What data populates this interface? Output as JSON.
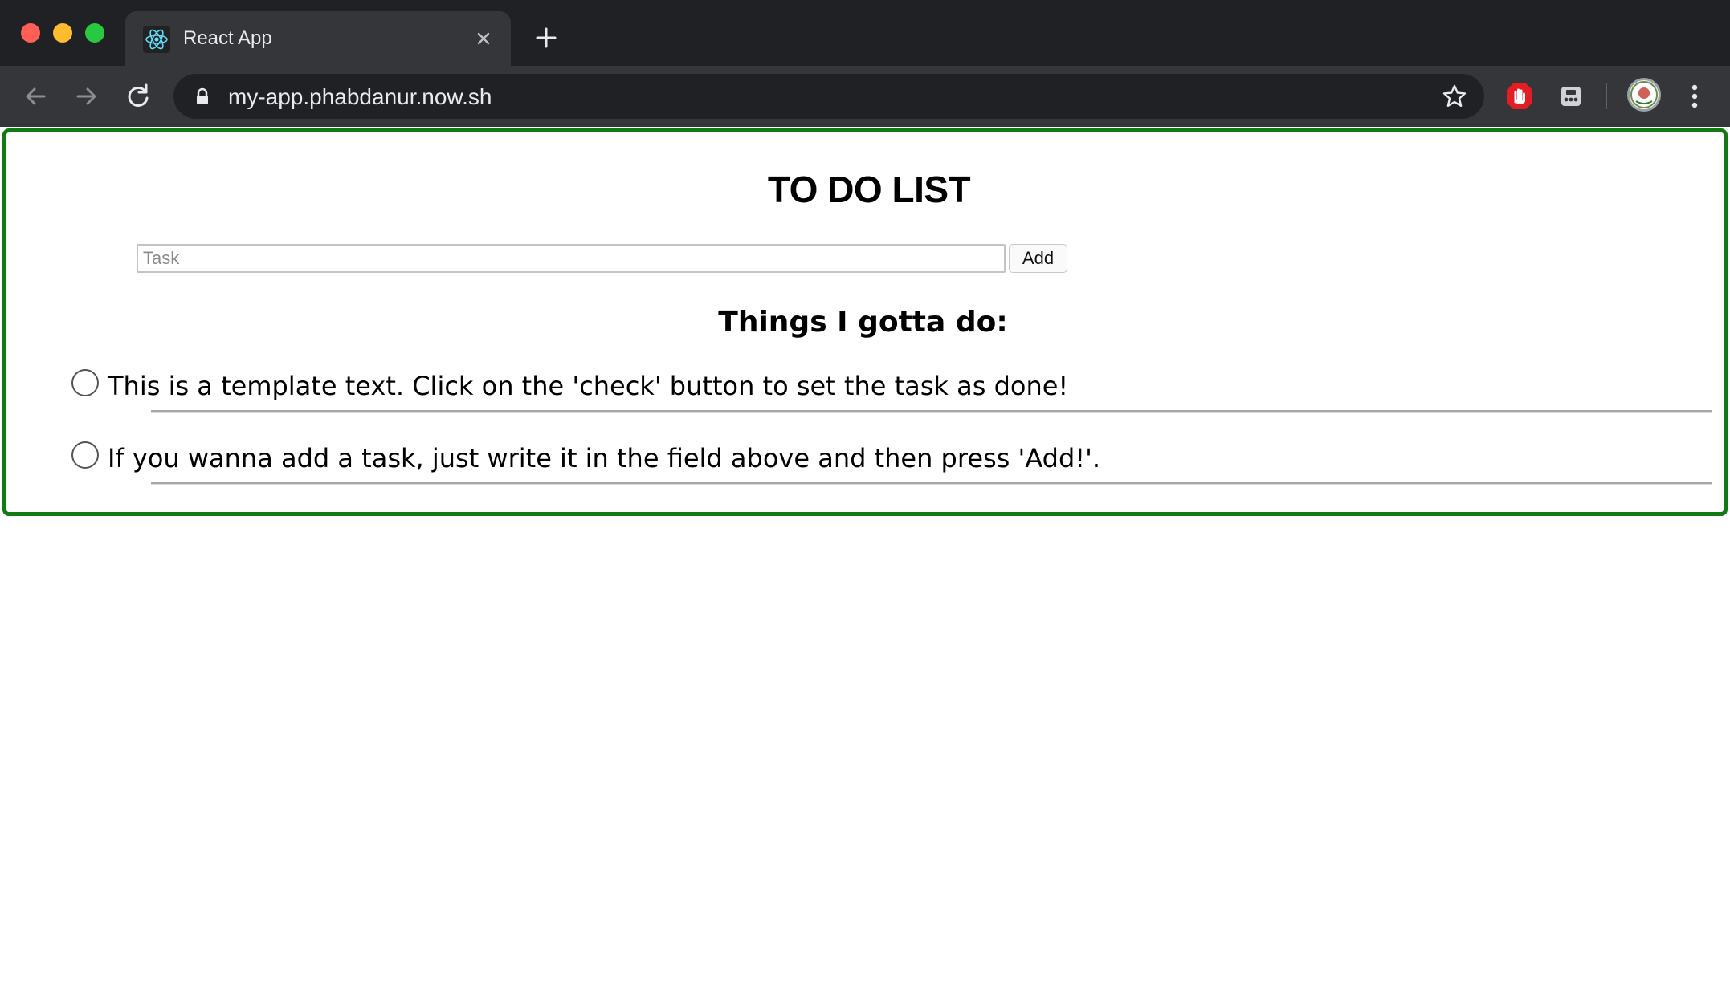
{
  "browser": {
    "tab": {
      "title": "React App"
    },
    "address_bar": {
      "url": "my-app.phabdanur.now.sh"
    }
  },
  "app": {
    "title": "TO DO LIST",
    "task_input": {
      "value": "",
      "placeholder": "Task"
    },
    "add_button_label": "Add",
    "list_heading": "Things I gotta do:",
    "items": [
      {
        "text": "This is a template text. Click on the 'check' button to set the task as done!",
        "done": false
      },
      {
        "text": "If you wanna add a task, just write it in the field above and then press 'Add!'.",
        "done": false
      }
    ]
  },
  "colors": {
    "frame_border": "#117a11",
    "chrome_dark": "#202124",
    "chrome_toolbar": "#35363a"
  }
}
